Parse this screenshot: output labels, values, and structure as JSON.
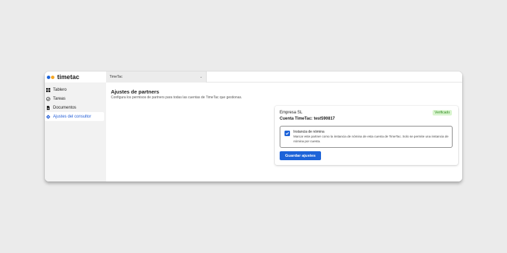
{
  "brand": {
    "name": "timetac",
    "dot_colors": [
      "#1d63d8",
      "#f5a623"
    ]
  },
  "topbar": {
    "account_select_value": "TimeTac"
  },
  "sidebar": {
    "items": [
      {
        "label": "Tablero",
        "icon": "dashboard-icon"
      },
      {
        "label": "Tareas",
        "icon": "check-circle-icon"
      },
      {
        "label": "Documentos",
        "icon": "document-icon"
      },
      {
        "label": "Ajustes del consultor",
        "icon": "gear-icon",
        "active": true
      }
    ]
  },
  "main": {
    "title": "Ajustes de partners",
    "subtitle": "Configura los permisos de partners para todas las cuentas de TimeTac que gestionas.",
    "card": {
      "company": "Empresa SL",
      "account": "Cuenta TimeTac: test590817",
      "badge": "Verificado",
      "option": {
        "checked": true,
        "title": "Instancia de nómina",
        "description": "Marcar este partner como la instancia de nómina de esta cuenta de TimeTac. Solo se permite una instancia de nómina por cuenta."
      },
      "save_label": "Guardar ajustes"
    }
  },
  "colors": {
    "accent": "#1d63d8",
    "badge_bg": "#d9f5cf",
    "badge_text": "#2e8a1e",
    "sidebar_bg": "#f2f2f2",
    "page_bg": "#ebebeb"
  }
}
